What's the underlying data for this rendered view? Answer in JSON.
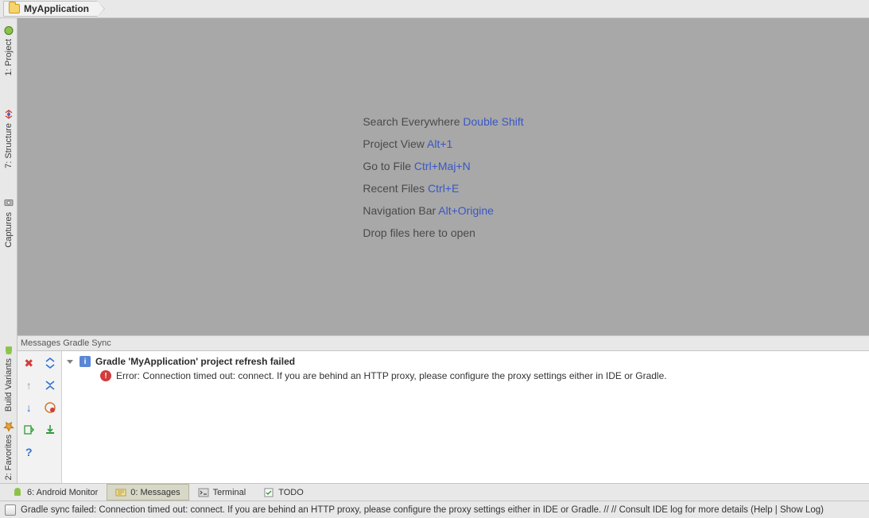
{
  "breadcrumb": {
    "project_name": "MyApplication"
  },
  "left_tabs": {
    "project": "1: Project",
    "structure": "7: Structure",
    "captures": "Captures",
    "variants": "Build Variants",
    "favorites": "2: Favorites"
  },
  "tips": {
    "search_label": "Search Everywhere",
    "search_key": "Double Shift",
    "projview_label": "Project View",
    "projview_key": "Alt+1",
    "gotofile_label": "Go to File",
    "gotofile_key": "Ctrl+Maj+N",
    "recent_label": "Recent Files",
    "recent_key": "Ctrl+E",
    "navbar_label": "Navigation Bar",
    "navbar_key": "Alt+Origine",
    "drop_label": "Drop files here to open"
  },
  "messages": {
    "tool_title": "Messages Gradle Sync",
    "header": "Gradle 'MyApplication' project refresh failed",
    "error_prefix": "Error:",
    "error_body": "Connection timed out: connect. If you are behind an HTTP proxy, please configure the proxy settings either in IDE or Gradle."
  },
  "bottom_tabs": {
    "android_monitor": "6: Android Monitor",
    "messages": "0: Messages",
    "terminal": "Terminal",
    "todo": "TODO"
  },
  "status": {
    "text": "Gradle sync failed: Connection timed out: connect. If you are behind an HTTP proxy, please configure the proxy settings either in IDE or Gradle. // // Consult IDE log for more details (Help | Show Log)"
  }
}
